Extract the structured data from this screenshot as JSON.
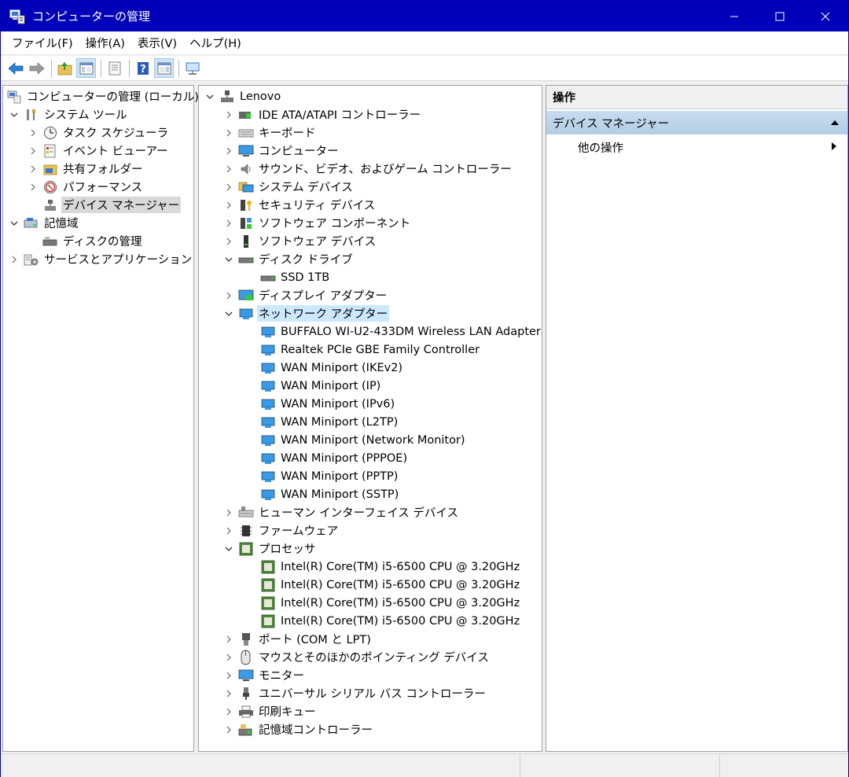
{
  "window": {
    "title": "コンピューターの管理",
    "title_bar_color": "#0000b8"
  },
  "menu": {
    "items": [
      {
        "label": "ファイル(F)"
      },
      {
        "label": "操作(A)"
      },
      {
        "label": "表示(V)"
      },
      {
        "label": "ヘルプ(H)"
      }
    ]
  },
  "toolbar": {
    "buttons": [
      {
        "icon": "back-arrow-icon"
      },
      {
        "icon": "forward-arrow-icon"
      },
      {
        "icon": "up-folder-icon"
      },
      {
        "icon": "show-hide-console-tree-icon"
      },
      {
        "icon": "properties-icon"
      },
      {
        "icon": "help-icon"
      },
      {
        "icon": "show-hide-action-pane-icon"
      },
      {
        "icon": "monitor-icon"
      }
    ]
  },
  "tree": {
    "root": "コンピューターの管理 (ローカル)",
    "system_tools": "システム ツール",
    "task_scheduler": "タスク スケジューラ",
    "event_viewer": "イベント ビューアー",
    "shared_folders": "共有フォルダー",
    "performance": "パフォーマンス",
    "device_manager": "デバイス マネージャー",
    "storage": "記憶域",
    "disk_management": "ディスクの管理",
    "services_apps": "サービスとアプリケーション"
  },
  "devices": {
    "root": "Lenovo",
    "ide": "IDE ATA/ATAPI コントローラー",
    "keyboard": "キーボード",
    "computer": "コンピューター",
    "sound": "サウンド、ビデオ、およびゲーム コントローラー",
    "system_devices": "システム デバイス",
    "security_devices": "セキュリティ デバイス",
    "software_components": "ソフトウェア コンポーネント",
    "software_devices": "ソフトウェア デバイス",
    "disk_drives": "ディスク ドライブ",
    "disk_items": [
      "SSD 1TB"
    ],
    "display_adapters": "ディスプレイ アダプター",
    "network_adapters": "ネットワーク アダプター",
    "network_items": [
      "BUFFALO WI-U2-433DM Wireless LAN Adapter",
      "Realtek PCIe GBE Family Controller",
      "WAN Miniport (IKEv2)",
      "WAN Miniport (IP)",
      "WAN Miniport (IPv6)",
      "WAN Miniport (L2TP)",
      "WAN Miniport (Network Monitor)",
      "WAN Miniport (PPPOE)",
      "WAN Miniport (PPTP)",
      "WAN Miniport (SSTP)"
    ],
    "hid": "ヒューマン インターフェイス デバイス",
    "firmware": "ファームウェア",
    "processors": "プロセッサ",
    "processor_items": [
      "Intel(R) Core(TM) i5-6500 CPU @ 3.20GHz",
      "Intel(R) Core(TM) i5-6500 CPU @ 3.20GHz",
      "Intel(R) Core(TM) i5-6500 CPU @ 3.20GHz",
      "Intel(R) Core(TM) i5-6500 CPU @ 3.20GHz"
    ],
    "ports": "ポート (COM と LPT)",
    "mice": "マウスとそのほかのポインティング デバイス",
    "monitors": "モニター",
    "usb": "ユニバーサル シリアル バス コントローラー",
    "print_queues": "印刷キュー",
    "storage_controllers": "記憶域コントローラー"
  },
  "actions": {
    "header": "操作",
    "section": "デバイス マネージャー",
    "other": "他の操作",
    "section_color": "#c7dcef"
  }
}
